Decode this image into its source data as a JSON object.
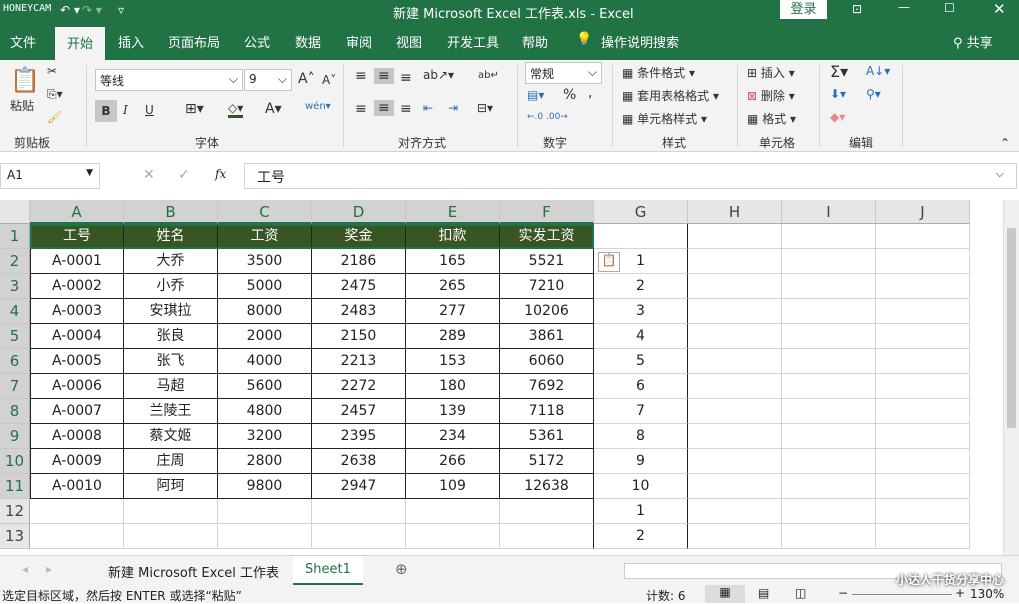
{
  "title": {
    "watermark": "HONEYCAM",
    "doc": "新建 Microsoft Excel 工作表.xls  -  Excel",
    "login": "登录"
  },
  "tabs": [
    "文件",
    "开始",
    "插入",
    "页面布局",
    "公式",
    "数据",
    "审阅",
    "视图",
    "开发工具",
    "帮助"
  ],
  "tell_me": "操作说明搜索",
  "share": "共享",
  "ribbon": {
    "paste": "粘贴",
    "font_name": "等线",
    "font_size": "9",
    "number_format": "常规",
    "cond_format": "条件格式",
    "table_format": "套用表格格式",
    "cell_style": "单元格样式",
    "insert": "插入",
    "delete": "删除",
    "format": "格式",
    "groups": [
      "剪贴板",
      "字体",
      "对齐方式",
      "数字",
      "样式",
      "单元格",
      "编辑"
    ],
    "bold": "B",
    "italic": "I",
    "underline": "U",
    "percent": "%",
    "comma": ","
  },
  "formula_bar": {
    "name_box": "A1",
    "fx": "fx",
    "value": "工号"
  },
  "columns": [
    "A",
    "B",
    "C",
    "D",
    "E",
    "F",
    "G",
    "H",
    "I",
    "J"
  ],
  "rows": [
    "1",
    "2",
    "3",
    "4",
    "5",
    "6",
    "7",
    "8",
    "9",
    "10",
    "11",
    "12",
    "13"
  ],
  "table": {
    "headers": [
      "工号",
      "姓名",
      "工资",
      "奖金",
      "扣款",
      "实发工资"
    ],
    "data": [
      [
        "A-0001",
        "大乔",
        "3500",
        "2186",
        "165",
        "5521"
      ],
      [
        "A-0002",
        "小乔",
        "5000",
        "2475",
        "265",
        "7210"
      ],
      [
        "A-0003",
        "安琪拉",
        "8000",
        "2483",
        "277",
        "10206"
      ],
      [
        "A-0004",
        "张良",
        "2000",
        "2150",
        "289",
        "3861"
      ],
      [
        "A-0005",
        "张飞",
        "4000",
        "2213",
        "153",
        "6060"
      ],
      [
        "A-0006",
        "马超",
        "5600",
        "2272",
        "180",
        "7692"
      ],
      [
        "A-0007",
        "兰陵王",
        "4800",
        "2457",
        "139",
        "7118"
      ],
      [
        "A-0008",
        "蔡文姬",
        "3200",
        "2395",
        "234",
        "5361"
      ],
      [
        "A-0009",
        "庄周",
        "2800",
        "2638",
        "266",
        "5172"
      ],
      [
        "A-0010",
        "阿珂",
        "9800",
        "2947",
        "109",
        "12638"
      ]
    ]
  },
  "col_g": [
    "",
    "1",
    "2",
    "3",
    "4",
    "5",
    "6",
    "7",
    "8",
    "9",
    "10",
    "1",
    "2"
  ],
  "sheets": [
    "新建 Microsoft Excel 工作表",
    "Sheet1"
  ],
  "status": {
    "message": "选定目标区域，然后按 ENTER 或选择“粘贴”",
    "count": "计数: 6",
    "zoom": "130%",
    "watermark2": "小达人干货分享中心"
  },
  "colors": {
    "brand": "#217346",
    "header_fill": "#375623"
  }
}
